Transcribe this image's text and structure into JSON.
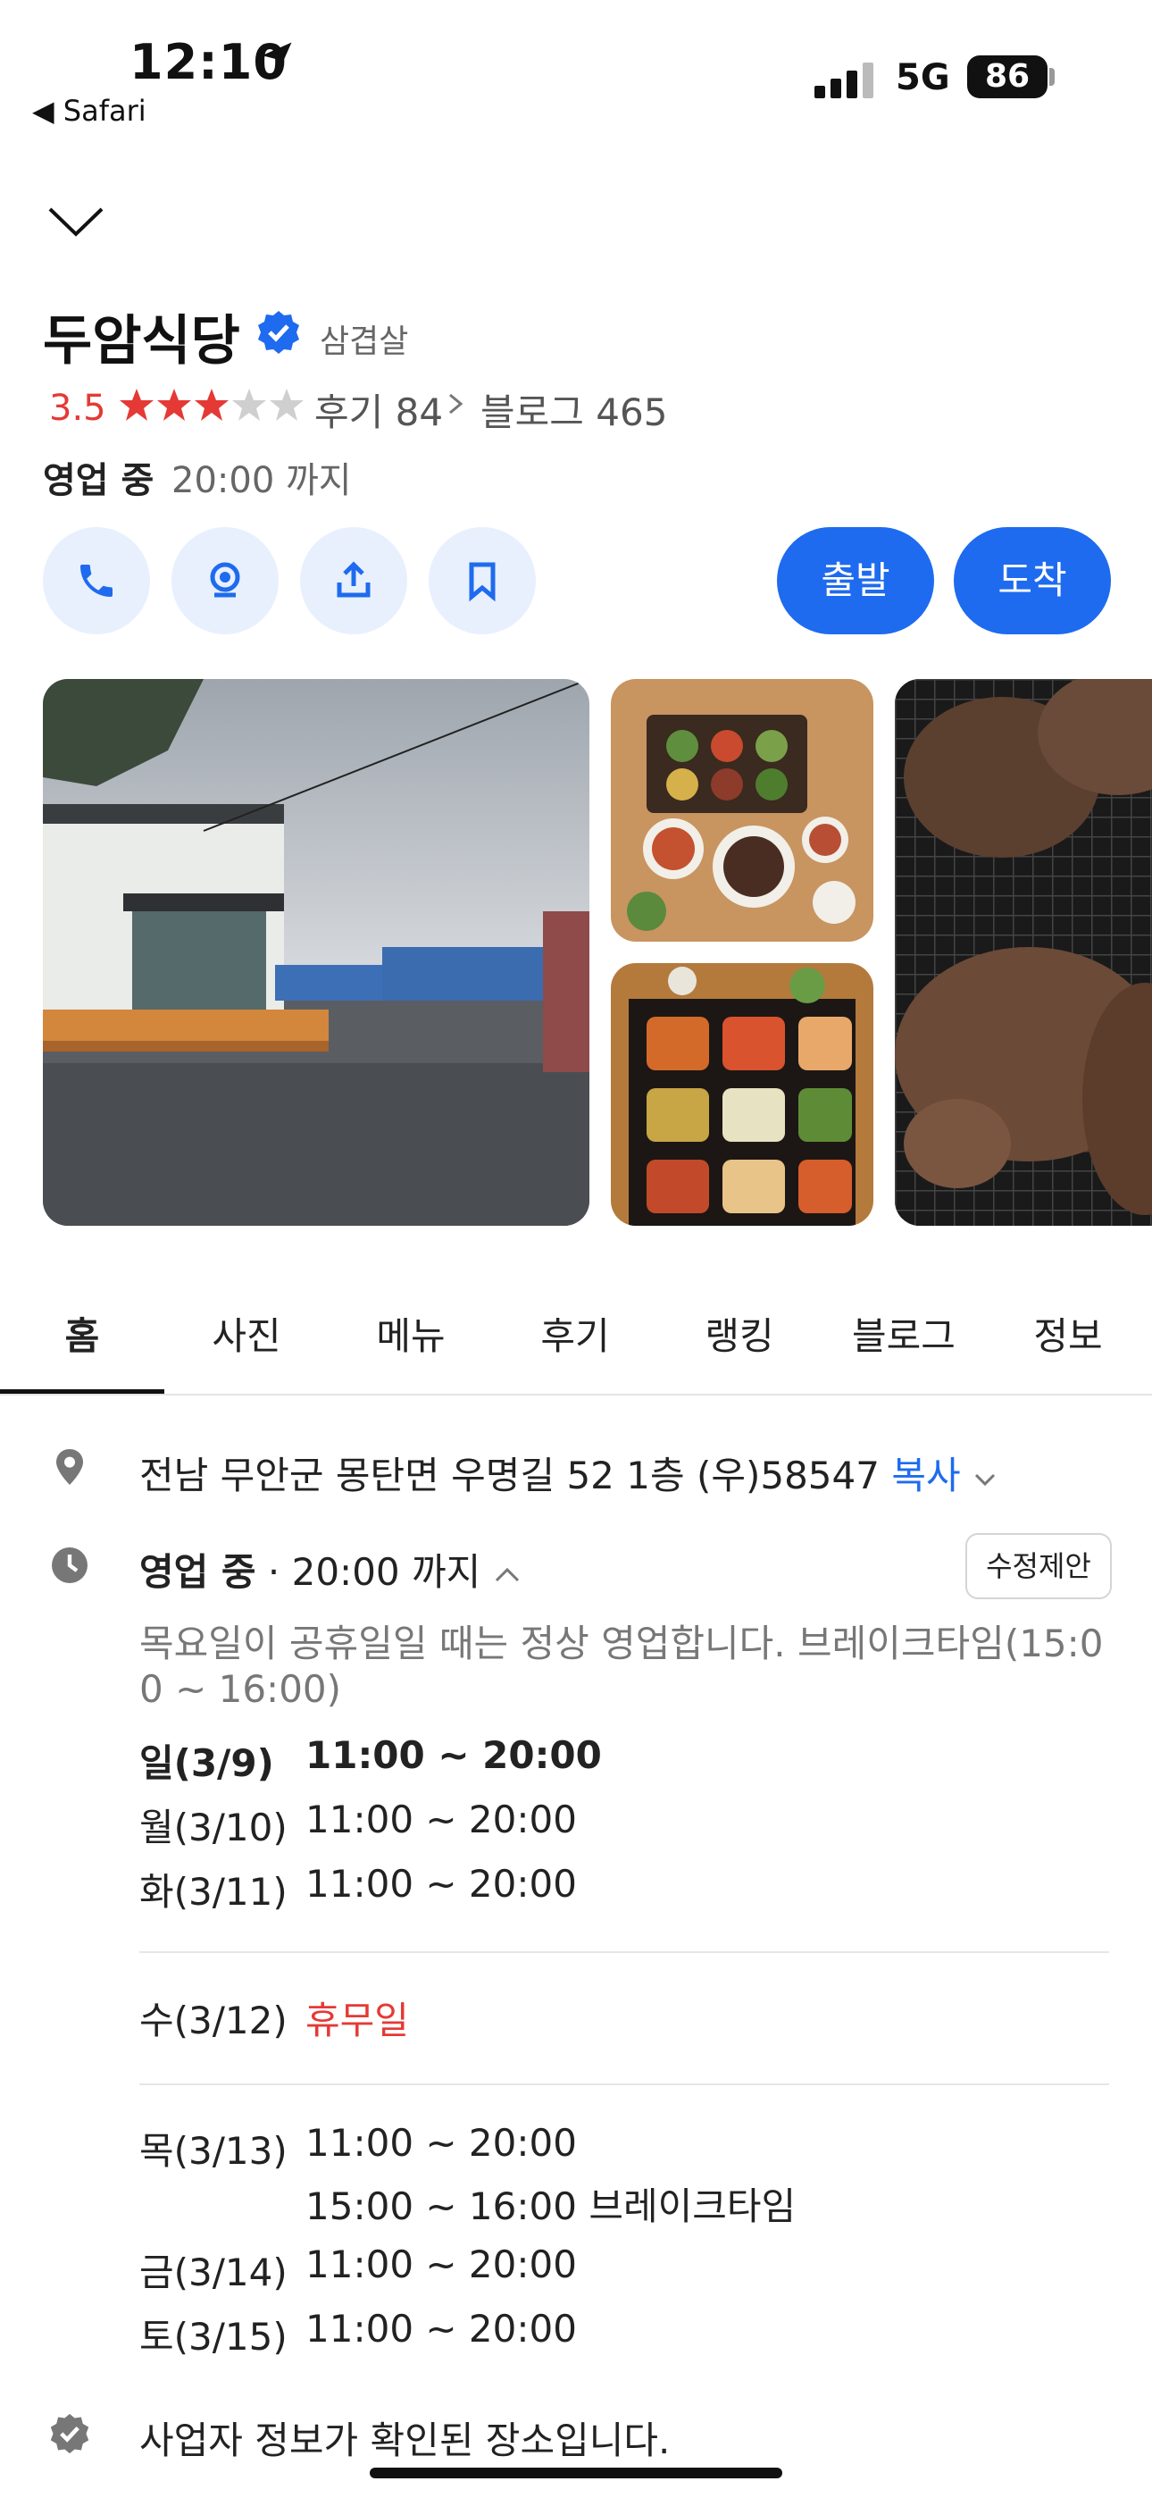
{
  "status_bar": {
    "time": "12:10",
    "back_app": "◀ Safari",
    "network": "5G",
    "battery": "86"
  },
  "place": {
    "name": "두암식당",
    "category": "삼겹살",
    "rating": "3.5",
    "rating_value": 3.5,
    "reviews": "후기 84",
    "blog": "블로그 465",
    "open_status": "영업 중",
    "open_until": "20:00 까지"
  },
  "actions": {
    "depart": "출발",
    "arrive": "도착"
  },
  "tabs": [
    "홈",
    "사진",
    "메뉴",
    "후기",
    "랭킹",
    "블로그",
    "정보"
  ],
  "address": {
    "text": "전남 무안군 몽탄면 우명길 52 1층 (우)58547",
    "copy": "복사"
  },
  "hours": {
    "status": "영업 중",
    "until": "· 20:00 까지",
    "suggest": "수정제안",
    "note": "목요일이 공휴일일 때는 정상 영업합니다. 브레이크타임(15:0",
    "note2": "0 ~ 16:00)",
    "days": [
      {
        "day": "일(3/9)",
        "time": "11:00 ~ 20:00"
      },
      {
        "day": "월(3/10)",
        "time": "11:00 ~ 20:00"
      },
      {
        "day": "화(3/11)",
        "time": "11:00 ~ 20:00"
      },
      {
        "day": "수(3/12)",
        "time": "휴무일"
      },
      {
        "day": "목(3/13)",
        "time": "11:00 ~ 20:00",
        "extra": "15:00 ~ 16:00 브레이크타임"
      },
      {
        "day": "금(3/14)",
        "time": "11:00 ~ 20:00"
      },
      {
        "day": "토(3/15)",
        "time": "11:00 ~ 20:00"
      }
    ]
  },
  "business_verified": "사업자 정보가 확인된 장소입니다.",
  "colors": {
    "accent": "#1e6bef",
    "closed": "#e53935",
    "star": "#e53935"
  }
}
